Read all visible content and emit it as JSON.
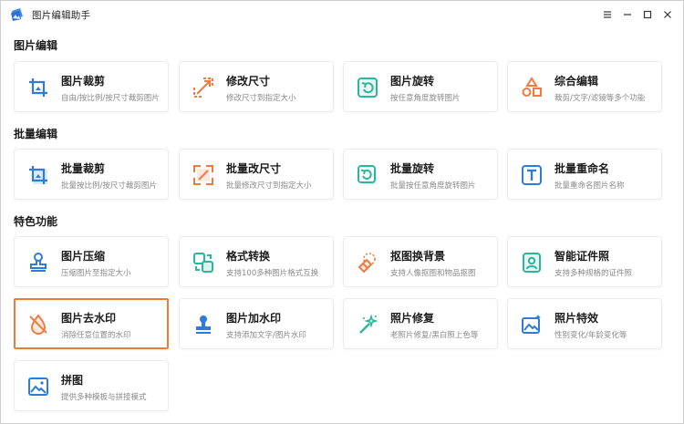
{
  "window": {
    "title": "图片编辑助手",
    "accent": "#2f7bdc",
    "highlight_color": "#ef7a3c"
  },
  "controls": {
    "menu": "menu-icon",
    "minimize": "minimize-icon",
    "maximize": "maximize-icon",
    "close": "close-icon"
  },
  "sections": [
    {
      "title": "图片编辑",
      "cards": [
        {
          "title": "图片裁剪",
          "desc": "自由/按比例/按尺寸裁剪图片",
          "icon": "crop-icon"
        },
        {
          "title": "修改尺寸",
          "desc": "修改尺寸到指定大小",
          "icon": "resize-icon"
        },
        {
          "title": "图片旋转",
          "desc": "按任意角度旋转图片",
          "icon": "rotate-icon"
        },
        {
          "title": "综合编辑",
          "desc": "裁剪/文字/滤镜等多个功能",
          "icon": "shapes-icon"
        }
      ]
    },
    {
      "title": "批量编辑",
      "cards": [
        {
          "title": "批量裁剪",
          "desc": "批量按比例/按尺寸裁剪图片",
          "icon": "batch-crop-icon"
        },
        {
          "title": "批量改尺寸",
          "desc": "批量修改尺寸到指定大小",
          "icon": "batch-resize-icon"
        },
        {
          "title": "批量旋转",
          "desc": "批量按任意角度旋转图片",
          "icon": "batch-rotate-icon"
        },
        {
          "title": "批量重命名",
          "desc": "批量重命名图片名称",
          "icon": "rename-icon"
        }
      ]
    },
    {
      "title": "特色功能",
      "cards": [
        {
          "title": "图片压缩",
          "desc": "压缩图片至指定大小",
          "icon": "stamp-icon"
        },
        {
          "title": "格式转换",
          "desc": "支持100多种图片格式互换",
          "icon": "convert-icon"
        },
        {
          "title": "抠图换背景",
          "desc": "支持人像抠图和物品抠图",
          "icon": "eraser-icon"
        },
        {
          "title": "智能证件照",
          "desc": "支持多种规格的证件照",
          "icon": "id-photo-icon"
        },
        {
          "title": "图片去水印",
          "desc": "消除任意位置的水印",
          "icon": "remove-watermark-icon",
          "selected": true
        },
        {
          "title": "图片加水印",
          "desc": "支持添加文字/图片水印",
          "icon": "add-watermark-icon"
        },
        {
          "title": "照片修复",
          "desc": "老照片修复/黑白照上色等",
          "icon": "magic-wand-icon"
        },
        {
          "title": "照片特效",
          "desc": "性别变化/年龄变化等",
          "icon": "photo-effect-icon"
        },
        {
          "title": "拼图",
          "desc": "提供多种模板与拼接模式",
          "icon": "collage-icon"
        }
      ]
    }
  ]
}
